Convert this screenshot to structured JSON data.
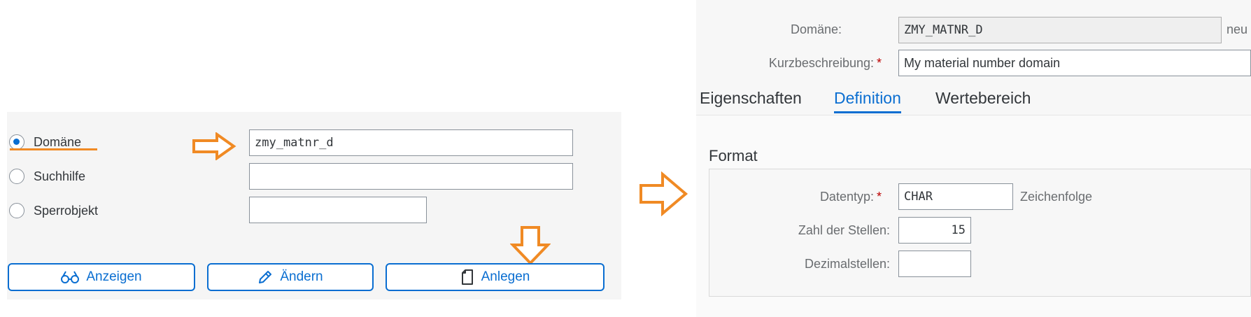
{
  "left_panel": {
    "radios": [
      {
        "label": "Domäne",
        "selected": true
      },
      {
        "label": "Suchhilfe",
        "selected": false
      },
      {
        "label": "Sperrobjekt",
        "selected": false
      }
    ],
    "inputs": [
      {
        "value": "zmy_matnr_d"
      },
      {
        "value": ""
      },
      {
        "value": ""
      }
    ],
    "buttons": {
      "display_label": "Anzeigen",
      "change_label": "Ändern",
      "create_label": "Anlegen"
    }
  },
  "right_panel": {
    "domain_label": "Domäne:",
    "domain_value": "ZMY_MATNR_D",
    "domain_status": "neu",
    "short_desc_label": "Kurzbeschreibung:",
    "short_desc_value": "My material number domain",
    "required_marker": "*",
    "tabs": [
      {
        "label": "Eigenschaften",
        "active": false
      },
      {
        "label": "Definition",
        "active": true
      },
      {
        "label": "Wertebereich",
        "active": false
      }
    ],
    "format_section": {
      "title": "Format",
      "datatype_label": "Datentyp:",
      "datatype_value": "CHAR",
      "datatype_desc": "Zeichenfolge",
      "length_label": "Zahl der Stellen:",
      "length_value": "15",
      "decimals_label": "Dezimalstellen:",
      "decimals_value": ""
    }
  },
  "colors": {
    "accent": "#0a6ed1",
    "annotation_orange": "#f08a24",
    "required_red": "#bb0000"
  },
  "icons": {
    "display": "glasses-icon",
    "change": "pencil-icon",
    "create": "document-icon"
  }
}
